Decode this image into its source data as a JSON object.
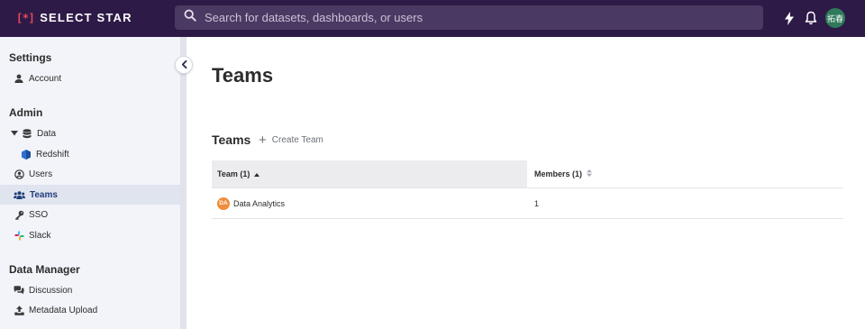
{
  "app": {
    "brand_mark": "[*]",
    "brand_name": "SELECT STAR"
  },
  "search": {
    "placeholder": "Search for datasets, dashboards, or users"
  },
  "topbar": {
    "user_initials": "拓春",
    "icons": [
      "bolt-icon",
      "bell-icon"
    ]
  },
  "sidebar": {
    "settings_title": "Settings",
    "account": "Account",
    "admin_title": "Admin",
    "data": "Data",
    "redshift": "Redshift",
    "users": "Users",
    "teams": "Teams",
    "sso": "SSO",
    "slack": "Slack",
    "data_manager_title": "Data Manager",
    "discussion": "Discussion",
    "metadata_upload": "Metadata Upload"
  },
  "main": {
    "page_title": "Teams",
    "section_title": "Teams",
    "create_team": "Create Team",
    "table": {
      "headers": [
        "Team (1)",
        "Members (1)"
      ],
      "rows": [
        {
          "initials": "DA",
          "name": "Data Analytics",
          "members": "1"
        }
      ]
    }
  },
  "colors": {
    "topbar": "#2d1a47",
    "active_item_text": "#1f3d7a",
    "team_avatar": "#ef8d3b",
    "user_avatar": "#2f7a5b"
  }
}
